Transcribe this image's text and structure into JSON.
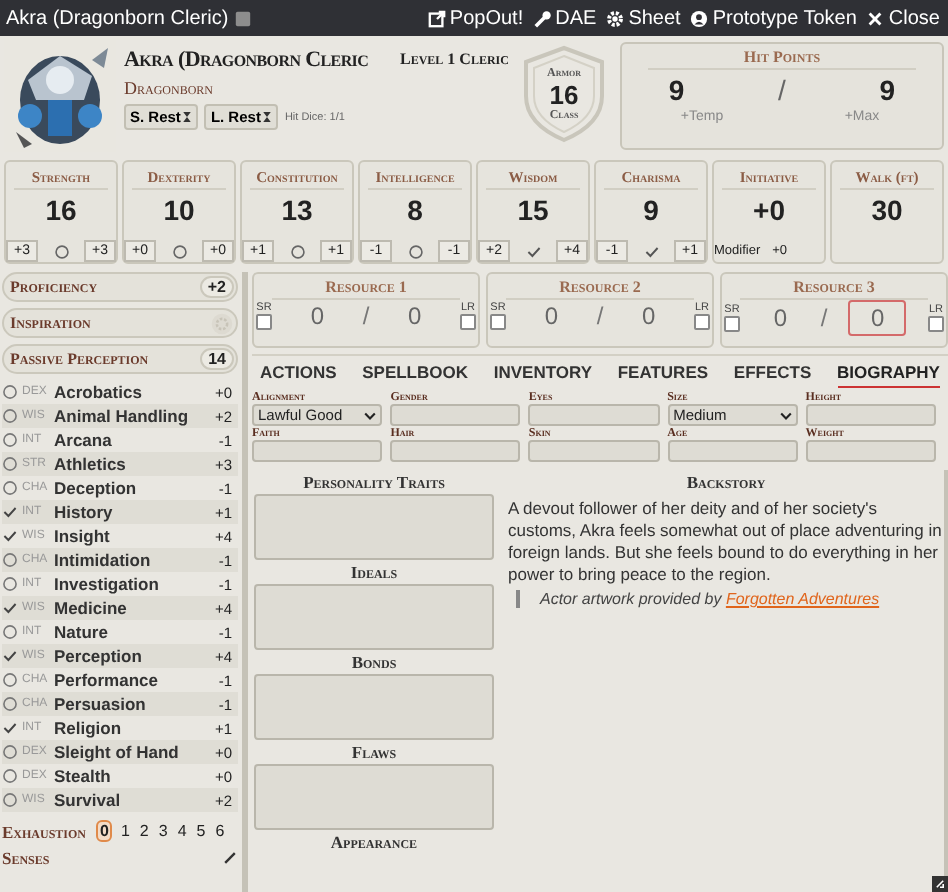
{
  "window": {
    "title": "Akra (Dragonborn Cleric)",
    "buttons": [
      {
        "kind": "popout",
        "label": "PopOut!"
      },
      {
        "kind": "dae",
        "label": "DAE"
      },
      {
        "kind": "sheet",
        "label": "Sheet"
      },
      {
        "kind": "token",
        "label": "Prototype Token"
      },
      {
        "kind": "close",
        "label": "Close"
      }
    ]
  },
  "header": {
    "name": "Akra (Dragonborn Cleric",
    "race": "Dragonborn",
    "level": "Level 1 Cleric",
    "rests": [
      "S. Rest",
      "L. Rest"
    ],
    "hit_dice": "Hit Dice: 1/1",
    "armor": {
      "top": "Armor",
      "value": "16",
      "bottom": "Class"
    },
    "hp": {
      "title": "Hit Points",
      "value": "9",
      "separator": "/",
      "max": "9",
      "temp_placeholder": "+Temp",
      "max_placeholder": "+Max"
    }
  },
  "abilities": [
    {
      "name": "Strength",
      "value": "16",
      "mod": "+3",
      "proficient": false,
      "save": "+3"
    },
    {
      "name": "Dexterity",
      "value": "10",
      "mod": "+0",
      "proficient": false,
      "save": "+0"
    },
    {
      "name": "Constitution",
      "value": "13",
      "mod": "+1",
      "proficient": false,
      "save": "+1"
    },
    {
      "name": "Intelligence",
      "value": "8",
      "mod": "-1",
      "proficient": false,
      "save": "-1"
    },
    {
      "name": "Wisdom",
      "value": "15",
      "mod": "+2",
      "proficient": true,
      "save": "+4"
    },
    {
      "name": "Charisma",
      "value": "9",
      "mod": "-1",
      "proficient": true,
      "save": "+1"
    }
  ],
  "initiative": {
    "name": "Initiative",
    "value": "+0",
    "label": "Modifier",
    "mod": "+0"
  },
  "movement": {
    "name": "Walk (ft)",
    "value": "30"
  },
  "attributes": [
    {
      "kind": "value",
      "label": "Proficiency",
      "value": "+2"
    },
    {
      "kind": "toggle",
      "label": "Inspiration",
      "on": false
    },
    {
      "kind": "value",
      "label": "Passive Perception",
      "value": "14"
    }
  ],
  "skills": [
    {
      "ability": "DEX",
      "name": "Acrobatics",
      "proficient": false,
      "mod": "+0"
    },
    {
      "ability": "WIS",
      "name": "Animal Handling",
      "proficient": false,
      "mod": "+2"
    },
    {
      "ability": "INT",
      "name": "Arcana",
      "proficient": false,
      "mod": "-1"
    },
    {
      "ability": "STR",
      "name": "Athletics",
      "proficient": false,
      "mod": "+3"
    },
    {
      "ability": "CHA",
      "name": "Deception",
      "proficient": false,
      "mod": "-1"
    },
    {
      "ability": "INT",
      "name": "History",
      "proficient": true,
      "mod": "+1"
    },
    {
      "ability": "WIS",
      "name": "Insight",
      "proficient": true,
      "mod": "+4"
    },
    {
      "ability": "CHA",
      "name": "Intimidation",
      "proficient": false,
      "mod": "-1"
    },
    {
      "ability": "INT",
      "name": "Investigation",
      "proficient": false,
      "mod": "-1"
    },
    {
      "ability": "WIS",
      "name": "Medicine",
      "proficient": true,
      "mod": "+4"
    },
    {
      "ability": "INT",
      "name": "Nature",
      "proficient": false,
      "mod": "-1"
    },
    {
      "ability": "WIS",
      "name": "Perception",
      "proficient": true,
      "mod": "+4"
    },
    {
      "ability": "CHA",
      "name": "Performance",
      "proficient": false,
      "mod": "-1"
    },
    {
      "ability": "CHA",
      "name": "Persuasion",
      "proficient": false,
      "mod": "-1"
    },
    {
      "ability": "INT",
      "name": "Religion",
      "proficient": true,
      "mod": "+1"
    },
    {
      "ability": "DEX",
      "name": "Sleight of Hand",
      "proficient": false,
      "mod": "+0"
    },
    {
      "ability": "DEX",
      "name": "Stealth",
      "proficient": false,
      "mod": "+0"
    },
    {
      "ability": "WIS",
      "name": "Survival",
      "proficient": false,
      "mod": "+2"
    }
  ],
  "exhaustion": {
    "label": "Exhaustion",
    "levels": [
      {
        "label": "0",
        "selected": true
      },
      {
        "label": "1",
        "selected": false
      },
      {
        "label": "2",
        "selected": false
      },
      {
        "label": "3",
        "selected": false
      },
      {
        "label": "4",
        "selected": false
      },
      {
        "label": "5",
        "selected": false
      },
      {
        "label": "6",
        "selected": false
      }
    ]
  },
  "senses": {
    "label": "Senses"
  },
  "resources": [
    {
      "title": "Resource 1",
      "sr": "SR",
      "sr_checked": false,
      "lr": "LR",
      "lr_checked": false,
      "value": "0",
      "separator": "/",
      "max": "0",
      "focused": false
    },
    {
      "title": "Resource 2",
      "sr": "SR",
      "sr_checked": false,
      "lr": "LR",
      "lr_checked": false,
      "value": "0",
      "separator": "/",
      "max": "0",
      "focused": false
    },
    {
      "title": "Resource 3",
      "sr": "SR",
      "sr_checked": false,
      "lr": "LR",
      "lr_checked": false,
      "value": "0",
      "separator": "/",
      "max": "0",
      "focused": true
    }
  ],
  "tabs": [
    {
      "label": "ACTIONS",
      "selected": false
    },
    {
      "label": "SPELLBOOK",
      "selected": false
    },
    {
      "label": "INVENTORY",
      "selected": false
    },
    {
      "label": "FEATURES",
      "selected": false
    },
    {
      "label": "EFFECTS",
      "selected": false
    },
    {
      "label": "BIOGRAPHY",
      "selected": true
    }
  ],
  "details": [
    {
      "kind": "select",
      "label": "Alignment",
      "value": "Lawful Good"
    },
    {
      "kind": "text",
      "label": "Gender"
    },
    {
      "kind": "text",
      "label": "Eyes"
    },
    {
      "kind": "select",
      "label": "Size",
      "value": "Medium"
    },
    {
      "kind": "text",
      "label": "Height"
    },
    {
      "kind": "text",
      "label": "Faith"
    },
    {
      "kind": "text",
      "label": "Hair"
    },
    {
      "kind": "text",
      "label": "Skin"
    },
    {
      "kind": "text",
      "label": "Age"
    },
    {
      "kind": "text",
      "label": "Weight"
    }
  ],
  "traits": [
    {
      "label": "Personality Traits"
    },
    {
      "label": "Ideals"
    },
    {
      "label": "Bonds"
    },
    {
      "label": "Flaws"
    },
    {
      "label": "Appearance"
    }
  ],
  "backstory": {
    "title": "Backstory",
    "text": "A devout follower of her deity and of her society's customs, Akra feels somewhat out of place adventuring in foreign lands. But she feels bound to do everything in her power to bring peace to the region.",
    "credit": "Actor artwork provided by",
    "link": "Forgotten Adventures"
  }
}
